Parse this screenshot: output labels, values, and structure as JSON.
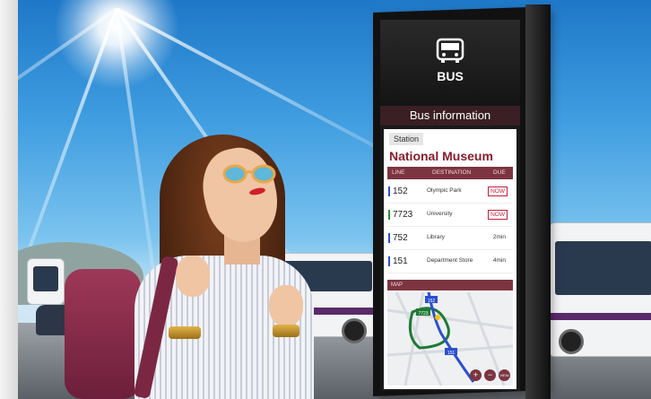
{
  "kiosk": {
    "icon": "bus-icon",
    "bus_label": "BUS",
    "header": "Bus information",
    "station_label": "Station",
    "station_name": "National Museum",
    "table_headers": {
      "line": "LINE",
      "destination": "DESTINATION",
      "due": "DUE"
    },
    "rows": [
      {
        "line": "152",
        "destination": "Olympic Park",
        "due": "NOW",
        "color": "#2b4fd1"
      },
      {
        "line": "7723",
        "destination": "University",
        "due": "NOW",
        "color": "#2a8f3b"
      },
      {
        "line": "752",
        "destination": "Library",
        "due": "2min",
        "color": "#2b4fd1"
      },
      {
        "line": "151",
        "destination": "Department Store",
        "due": "4min",
        "color": "#2b4fd1"
      }
    ],
    "map_label": "MAP",
    "map_markers": [
      "152",
      "7723",
      "151"
    ],
    "map_controls": {
      "zoom_in": "+",
      "zoom_out": "−",
      "view": "VIEW"
    },
    "accent_color": "#7c3540",
    "alert_color": "#c31e3a"
  }
}
